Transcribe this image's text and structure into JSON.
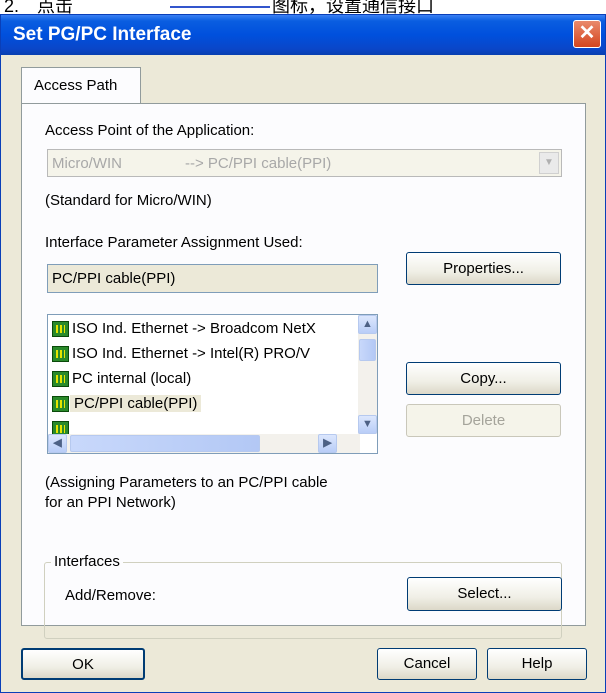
{
  "page": {
    "header_fragment": "2.　点击",
    "header_fragment2": "图标，设置通信接口"
  },
  "dialog": {
    "title": "Set PG/PC Interface",
    "close_label": "✕",
    "tab_label": "Access Path",
    "access_point_label": "Access Point of the Application:",
    "access_point_value_app": "Micro/WIN",
    "access_point_value_iface": "--> PC/PPI cable(PPI)",
    "standard_note": "(Standard for Micro/WIN)",
    "param_assignment_label": "Interface Parameter Assignment Used:",
    "param_assignment_value": "PC/PPI cable(PPI)",
    "interfaces_list": [
      "ISO Ind. Ethernet -> Broadcom NetX",
      "ISO Ind. Ethernet -> Intel(R) PRO/V",
      "PC internal (local)",
      "PC/PPI cable(PPI)"
    ],
    "selected_index": 3,
    "description": "(Assigning Parameters to an PC/PPI cable",
    "description_line2": "for an PPI Network)",
    "interfaces_group_label": "Interfaces",
    "add_remove_label": "Add/Remove:",
    "buttons": {
      "properties": "Properties...",
      "copy": "Copy...",
      "delete": "Delete",
      "select": "Select...",
      "ok": "OK",
      "cancel": "Cancel",
      "help": "Help"
    }
  },
  "icons": {
    "list_item": "network-card-icon",
    "scroll_up": "arrow-up-icon",
    "scroll_down": "arrow-down-icon",
    "scroll_left": "arrow-left-icon",
    "scroll_right": "arrow-right-icon",
    "dropdown": "chevron-down-icon"
  },
  "colors": {
    "titlebar": "#0050dd",
    "dialog_bg": "#ece9d8",
    "close_button": "#d4451f"
  }
}
